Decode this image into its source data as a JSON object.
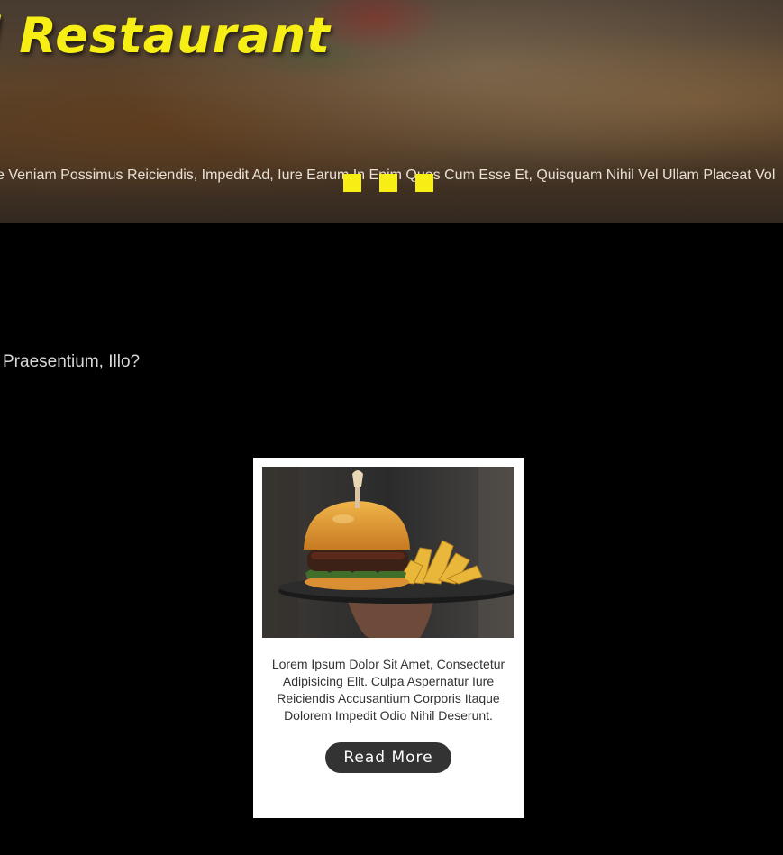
{
  "hero": {
    "title": "l Restaurant",
    "description": "e Veniam Possimus Reiciendis, Impedit Ad, Iure Earum In Enim Quos Cum Esse Et, Quisquam Nihil Vel Ullam Placeat Vol",
    "slide_dot_count": 3,
    "accent_color": "#f7ee16"
  },
  "section": {
    "tagline": "Praesentium, Illo?"
  },
  "card": {
    "image_icon": "burger-photo",
    "text": "Lorem Ipsum Dolor Sit Amet, Consectetur Adipisicing Elit. Culpa Aspernatur Iure Reiciendis Accusantium Corporis Itaque Dolorem Impedit Odio Nihil Deserunt.",
    "button_label": "Read More"
  }
}
